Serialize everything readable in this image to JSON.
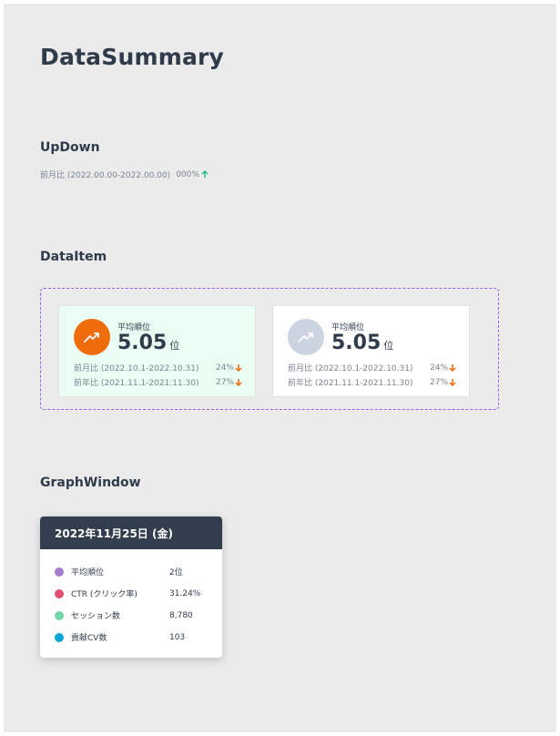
{
  "page": {
    "title": "DataSummary"
  },
  "updown": {
    "section_title": "UpDown",
    "label": "前月比 (2022.00.00-2022.00.00)",
    "value": "000%",
    "direction": "up",
    "arrow_icon": "arrow-up-icon",
    "arrow_color": "#2bbf8a"
  },
  "dataitem": {
    "section_title": "DataItem",
    "cards": [
      {
        "state": "active",
        "icon": "trending-up-icon",
        "icon_bg": "#ee6c0c",
        "bg": "#eafdf3",
        "label": "平均順位",
        "value": "5.05",
        "unit": "位",
        "rows": [
          {
            "label": "前月比 (2022.10.1-2022.10.31)",
            "value": "24%",
            "direction": "down"
          },
          {
            "label": "前年比 (2021.11.1-2021.11.30)",
            "value": "27%",
            "direction": "down"
          }
        ]
      },
      {
        "state": "inactive",
        "icon": "trending-up-icon",
        "icon_bg": "#cdd3df",
        "bg": "#ffffff",
        "label": "平均順位",
        "value": "5.05",
        "unit": "位",
        "rows": [
          {
            "label": "前月比 (2022.10.1-2022.10.31)",
            "value": "24%",
            "direction": "down"
          },
          {
            "label": "前年比 (2021.11.1-2021.11.30)",
            "value": "27%",
            "direction": "down"
          }
        ]
      }
    ],
    "down_arrow_color": "#ee6c0c",
    "selection_border_color": "#9b5de5"
  },
  "graphwindow": {
    "section_title": "GraphWindow",
    "date": "2022年11月25日 (金)",
    "items": [
      {
        "name": "平均順位",
        "value": "2位",
        "color": "#a77bd1"
      },
      {
        "name": "CTR (クリック率)",
        "value": "31.24%",
        "color": "#e0506f"
      },
      {
        "name": "セッション数",
        "value": "8,780",
        "color": "#6fd8a6"
      },
      {
        "name": "貢献CV数",
        "value": "103",
        "color": "#0aa6d8"
      }
    ],
    "header_bg": "#323e4e"
  }
}
